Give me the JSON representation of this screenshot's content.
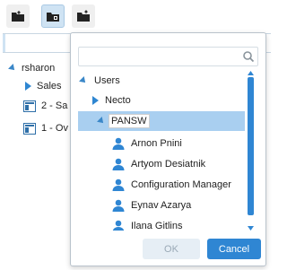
{
  "toolbar": {
    "buttons": [
      {
        "icon": "folder-import-icon"
      },
      {
        "icon": "folder-lock-icon"
      },
      {
        "icon": "folder-export-icon"
      }
    ]
  },
  "background_tree": {
    "root": "rsharon",
    "items": [
      "Sales",
      "2 - Sa",
      "1 - Ov"
    ]
  },
  "picker": {
    "search": {
      "value": "",
      "placeholder": ""
    },
    "tree": {
      "root_label": "Users",
      "nodes": [
        {
          "label": "Necto",
          "type": "group",
          "expanded": false
        },
        {
          "label": "PANSW",
          "type": "group",
          "expanded": true,
          "selected": true
        }
      ],
      "users": [
        "Arnon Pnini",
        "Artyom Desiatnik",
        "Configuration Manager",
        "Eynav Azarya",
        "Ilana Gitlins"
      ]
    },
    "ok_label": "OK",
    "cancel_label": "Cancel"
  },
  "colors": {
    "accent": "#2f86d3",
    "selection": "#a9cff0",
    "ok_disabled": "#e6eef5"
  }
}
